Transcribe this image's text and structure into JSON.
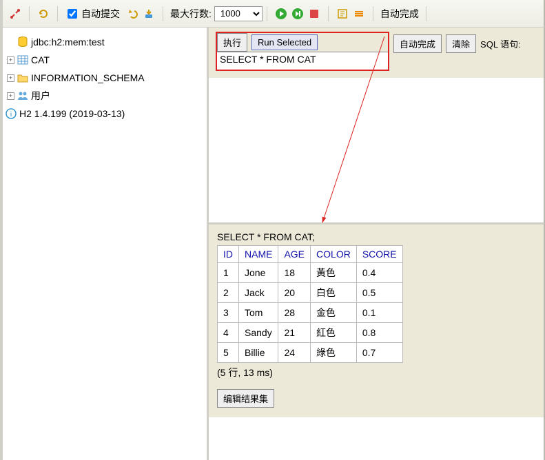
{
  "toolbar": {
    "autocommit_label": "自动提交",
    "maxrows_label": "最大行数:",
    "maxrows_value": "1000",
    "autocomplete_label": "自动完成"
  },
  "tree": {
    "conn": "jdbc:h2:mem:test",
    "items": [
      {
        "label": "CAT",
        "icon": "table"
      },
      {
        "label": "INFORMATION_SCHEMA",
        "icon": "folder"
      },
      {
        "label": "用户",
        "icon": "users"
      }
    ],
    "version": "H2 1.4.199 (2019-03-13)"
  },
  "cmd": {
    "run": "执行",
    "run_selected": "Run Selected",
    "autocomplete": "自动完成",
    "clear": "清除",
    "sql_label": "SQL 语句:",
    "sql_text": "SELECT * FROM CAT"
  },
  "result": {
    "echo": "SELECT * FROM CAT;",
    "columns": [
      "ID",
      "NAME",
      "AGE",
      "COLOR",
      "SCORE"
    ],
    "rows": [
      [
        "1",
        "Jone",
        "18",
        "黃色",
        "0.4"
      ],
      [
        "2",
        "Jack",
        "20",
        "白色",
        "0.5"
      ],
      [
        "3",
        "Tom",
        "28",
        "金色",
        "0.1"
      ],
      [
        "4",
        "Sandy",
        "21",
        "紅色",
        "0.8"
      ],
      [
        "5",
        "Billie",
        "24",
        "綠色",
        "0.7"
      ]
    ],
    "summary": "(5 行, 13 ms)",
    "edit_label": "编辑结果集"
  }
}
